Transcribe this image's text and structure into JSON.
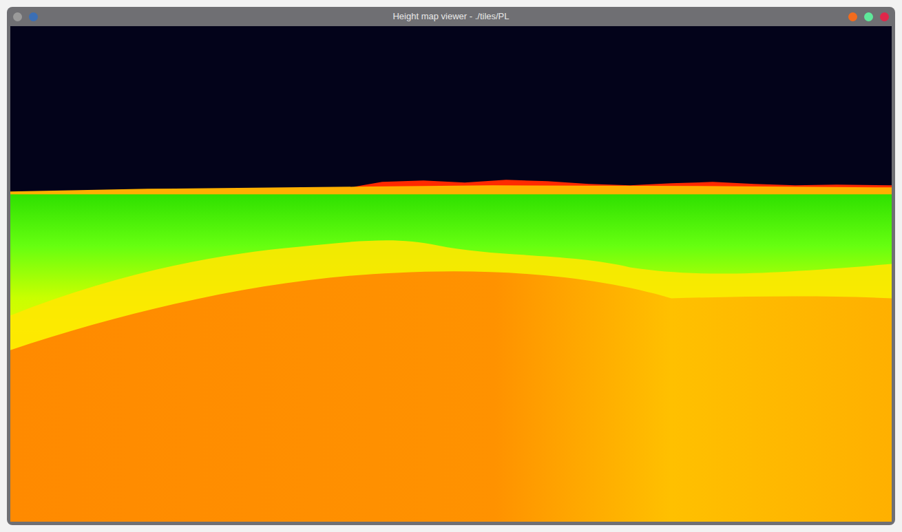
{
  "window": {
    "title": "Height map viewer - ./tiles/PL"
  },
  "left_controls": [
    {
      "color": "#9a9a9a"
    },
    {
      "color": "#3b6fb6"
    }
  ],
  "right_controls": [
    {
      "color": "#f26b1d"
    },
    {
      "color": "#5ee89a"
    },
    {
      "color": "#e0264a"
    }
  ]
}
